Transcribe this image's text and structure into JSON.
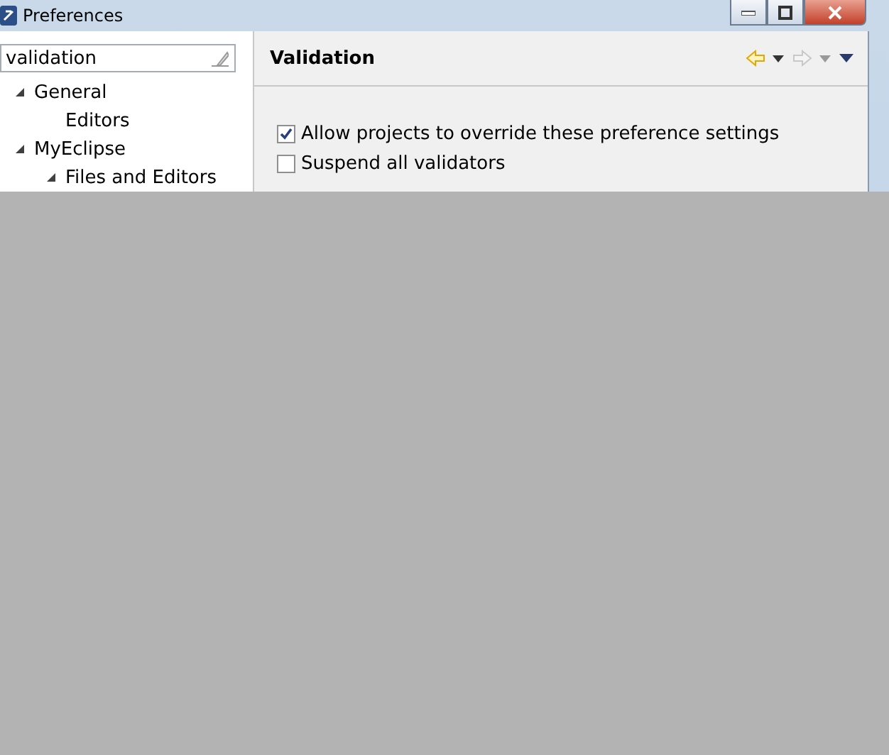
{
  "window": {
    "title": "Preferences"
  },
  "filter": {
    "value": "validation"
  },
  "tree": [
    {
      "label": "General",
      "expanded": true,
      "children": [
        {
          "label": "Editors"
        }
      ]
    },
    {
      "label": "MyEclipse",
      "expanded": true,
      "children": [
        {
          "label": "Files and Editors",
          "expanded": true
        }
      ]
    }
  ],
  "page": {
    "title": "Validation",
    "nav": [
      {
        "kind": "back",
        "disabled": false
      },
      {
        "kind": "forward",
        "disabled": true
      }
    ]
  },
  "options": [
    {
      "label": "Allow projects to override these preference settings",
      "checked": true
    },
    {
      "label": "Suspend all validators",
      "checked": false
    }
  ]
}
